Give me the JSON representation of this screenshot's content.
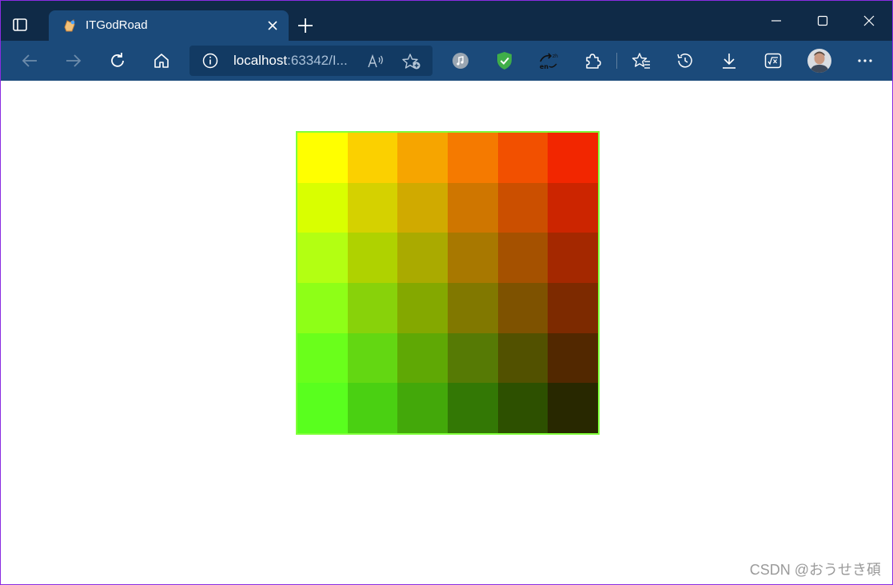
{
  "browser": {
    "tab": {
      "title": "ITGodRoad"
    },
    "address": {
      "host": "localhost",
      "rest": ":63342/I..."
    }
  },
  "icons": {
    "tab_actions": "tab-actions-icon",
    "favicon": "page-favicon-icon",
    "tab_close": "close-icon",
    "new_tab": "plus-icon",
    "minimize": "minimize-icon",
    "maximize": "maximize-icon",
    "window_close": "close-icon",
    "back": "back-arrow-icon",
    "forward": "forward-arrow-icon",
    "refresh": "refresh-icon",
    "home": "home-icon",
    "info": "info-icon",
    "read_aloud": "read-aloud-icon",
    "add_favorite": "add-favorite-icon",
    "music_extension": "music-extension-icon",
    "shield_extension": "shield-check-icon",
    "translate_extension": "translate-icon",
    "extensions": "puzzle-icon",
    "favorites": "favorites-icon",
    "history": "history-icon",
    "downloads": "download-icon",
    "math_solver": "math-solver-icon",
    "profile": "avatar",
    "more": "more-icon"
  },
  "colors": {
    "titlebar": "#0f2a47",
    "toolbar": "#1b4a7a",
    "grid_border": "#7fff3a",
    "watermark": "#9a9a9a"
  },
  "grid": {
    "rows": [
      [
        "#ffff00",
        "#fbd000",
        "#f6a500",
        "#f57a00",
        "#f25000",
        "#f22600"
      ],
      [
        "#d9ff00",
        "#d5d100",
        "#d0aa00",
        "#cf7600",
        "#cb4f00",
        "#cc2500"
      ],
      [
        "#b3ff12",
        "#afd200",
        "#aaaa00",
        "#a87800",
        "#a55100",
        "#a42800"
      ],
      [
        "#8eff17",
        "#88d20a",
        "#84a800",
        "#817800",
        "#7e5200",
        "#7d2a00"
      ],
      [
        "#6aff1b",
        "#63d712",
        "#5fa805",
        "#567a05",
        "#525100",
        "#522800"
      ],
      [
        "#59ff1e",
        "#4ad012",
        "#43a80a",
        "#337805",
        "#2d5000",
        "#282800"
      ]
    ]
  },
  "watermark": "CSDN @おうせき碩"
}
